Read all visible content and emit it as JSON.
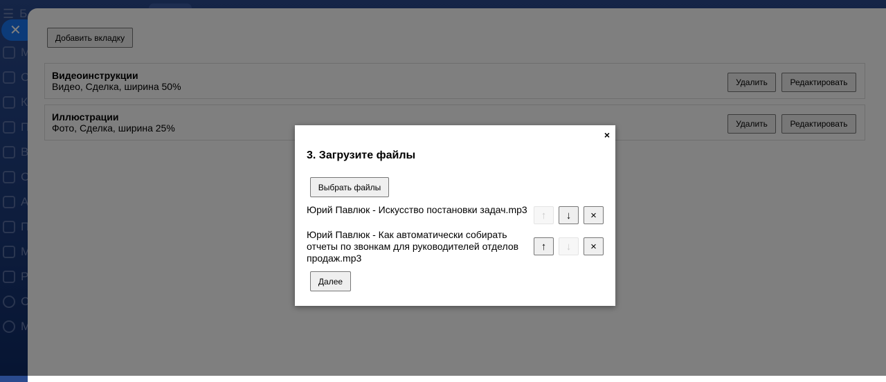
{
  "sidebar": {
    "header_letter": "Б",
    "items": [
      "М",
      "С",
      "К",
      "П",
      "В",
      "С",
      "А",
      "П",
      "М",
      "Р",
      "С",
      "М"
    ]
  },
  "panel": {
    "add_tab_label": "Добавить вкладку",
    "tabs": [
      {
        "title": "Видеоинструкции",
        "subtitle": "Видео, Сделка, ширина 50%",
        "delete_label": "Удалить",
        "edit_label": "Редактировать"
      },
      {
        "title": "Иллюстрации",
        "subtitle": "Фото, Сделка, ширина 25%",
        "delete_label": "Удалить",
        "edit_label": "Редактировать"
      }
    ]
  },
  "modal": {
    "close": "×",
    "title": "3. Загрузите файлы",
    "choose_label": "Выбрать файлы",
    "files": [
      {
        "name": "Юрий Павлюк - Искусство постановки задач.mp3",
        "up_enabled": false,
        "down_enabled": true
      },
      {
        "name": "Юрий Павлюк - Как автоматически собирать отчеты по звонкам для руководителей отделов продаж.mp3",
        "up_enabled": true,
        "down_enabled": false
      }
    ],
    "up_icon": "↑",
    "down_icon": "↓",
    "remove_icon": "×",
    "next_label": "Далее"
  },
  "colors": {
    "accent": "#1877f2"
  }
}
